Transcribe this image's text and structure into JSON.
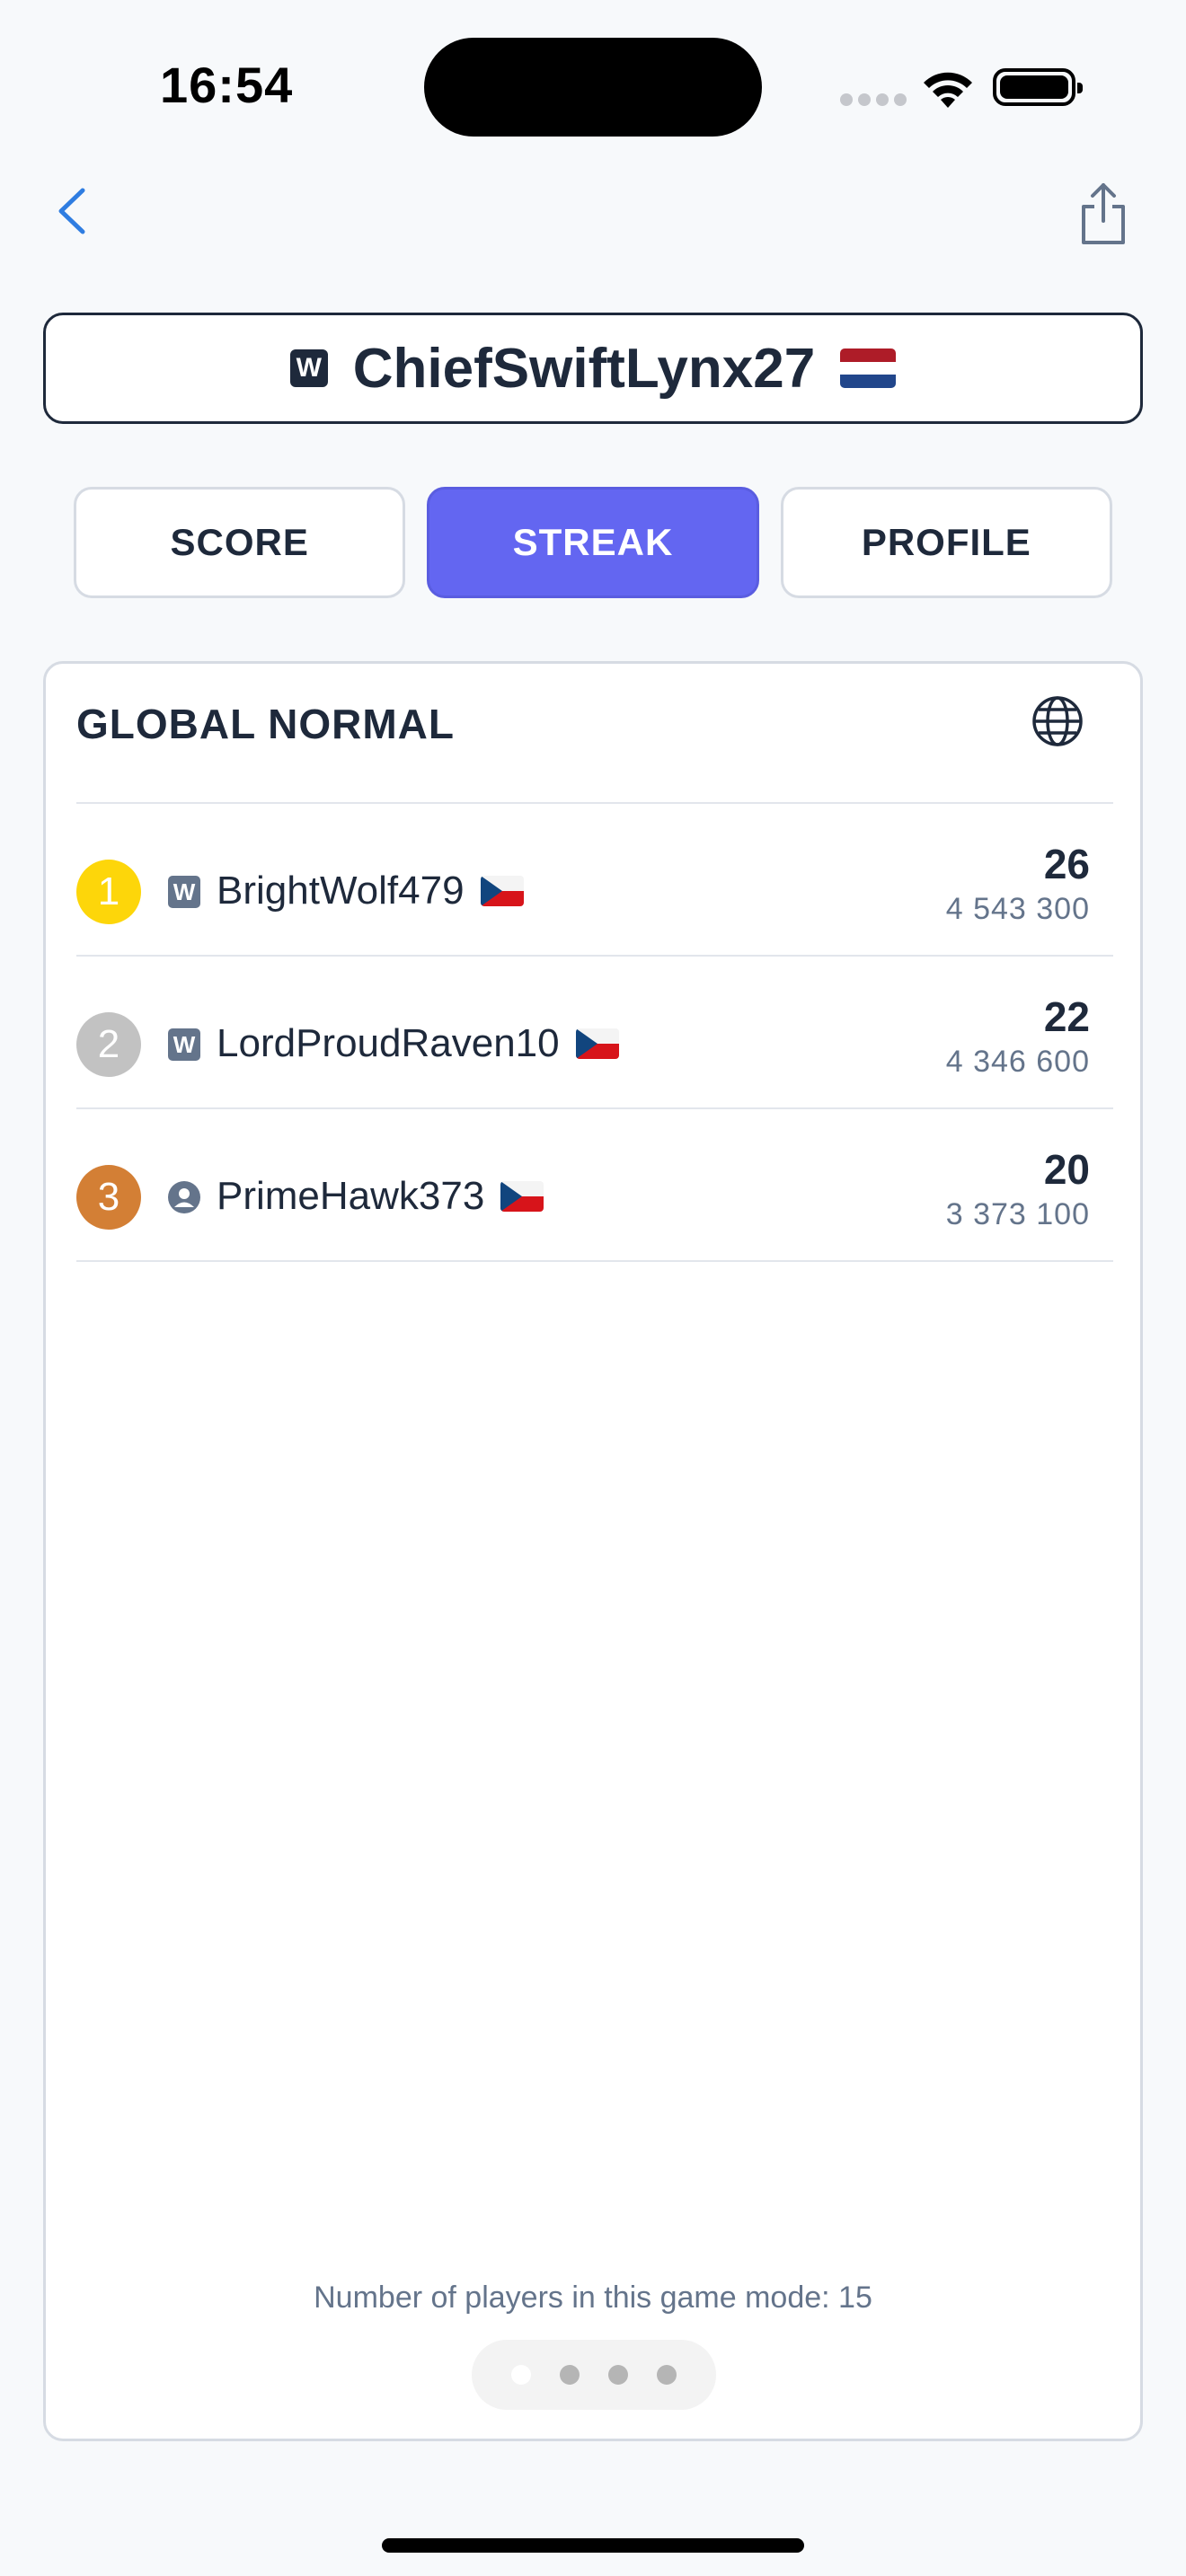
{
  "status_bar": {
    "time": "16:54"
  },
  "header": {
    "player_badge": "W",
    "player_name": "ChiefSwiftLynx27",
    "player_flag": "Netherlands"
  },
  "tabs": [
    {
      "label": "SCORE",
      "active": false
    },
    {
      "label": "STREAK",
      "active": true
    },
    {
      "label": "PROFILE",
      "active": false
    }
  ],
  "leaderboard": {
    "title": "GLOBAL NORMAL",
    "rows": [
      {
        "rank": "1",
        "badge": "W",
        "name": "BrightWolf479",
        "flag": "Czech Republic",
        "streak": "26",
        "score": "4 543 300"
      },
      {
        "rank": "2",
        "badge": "W",
        "name": "LordProudRaven10",
        "flag": "Czech Republic",
        "streak": "22",
        "score": "4 346 600"
      },
      {
        "rank": "3",
        "badge": "person-icon",
        "name": "PrimeHawk373",
        "flag": "Czech Republic",
        "streak": "20",
        "score": "3 373 100"
      }
    ],
    "footer": "Number of players in this game mode: 15",
    "pager": {
      "pages": 4,
      "current": 1
    }
  },
  "colors": {
    "accent": "#6366f1",
    "text": "#1e293b",
    "muted": "#64748b",
    "gold": "#fdd60a",
    "silver": "#c2c2c2",
    "bronze": "#d37f35"
  }
}
